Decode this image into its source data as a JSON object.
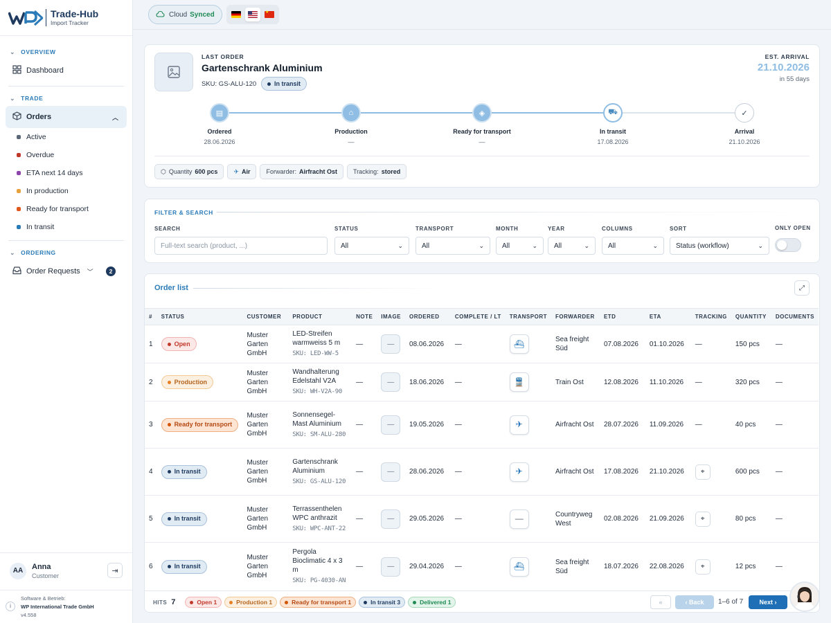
{
  "brand": {
    "title": "Trade-Hub",
    "subtitle": "Import Tracker"
  },
  "sidebar": {
    "overview_label": "OVERVIEW",
    "dashboard": "Dashboard",
    "trade_label": "TRADE",
    "orders": "Orders",
    "subitems": [
      {
        "label": "Active",
        "color": "#5a6777"
      },
      {
        "label": "Overdue",
        "color": "#c0392b"
      },
      {
        "label": "ETA next 14 days",
        "color": "#8e44ad"
      },
      {
        "label": "In production",
        "color": "#e6a23c"
      },
      {
        "label": "Ready for transport",
        "color": "#e0581c"
      },
      {
        "label": "In transit",
        "color": "#2b7bb9"
      }
    ],
    "ordering_label": "ORDERING",
    "order_requests": "Order Requests",
    "order_requests_count": "2"
  },
  "user": {
    "initials": "AA",
    "name": "Anna",
    "role": "Customer"
  },
  "footer": {
    "line1": "Software & Betrieb:",
    "line2": "WP International Trade GmbH",
    "version": "v4.558"
  },
  "topbar": {
    "cloud_label": "Cloud",
    "cloud_status": "Synced"
  },
  "last_order": {
    "label": "LAST ORDER",
    "title": "Gartenschrank Aluminium",
    "sku": "SKU: GS-ALU-120",
    "status": "In transit",
    "arrival_label": "EST. ARRIVAL",
    "arrival_date": "21.10.2026",
    "arrival_in": "in 55 days",
    "steps": [
      {
        "name": "Ordered",
        "date": "28.06.2026"
      },
      {
        "name": "Production",
        "date": "—"
      },
      {
        "name": "Ready for transport",
        "date": "—"
      },
      {
        "name": "In transit",
        "date": "17.08.2026"
      },
      {
        "name": "Arrival",
        "date": "21.10.2026"
      }
    ],
    "quantity_label": "Quantity",
    "quantity": "600 pcs",
    "mode": "Air",
    "forwarder_label": "Forwarder:",
    "forwarder": "Airfracht Ost",
    "tracking_label": "Tracking:",
    "tracking": "stored"
  },
  "filter": {
    "title": "FILTER & SEARCH",
    "search_label": "SEARCH",
    "search_placeholder": "Full-text search (product, ...)",
    "status_label": "STATUS",
    "status_value": "All",
    "transport_label": "TRANSPORT",
    "transport_value": "All",
    "month_label": "MONTH",
    "month_value": "All",
    "year_label": "YEAR",
    "year_value": "All",
    "columns_label": "COLUMNS",
    "columns_value": "All",
    "sort_label": "SORT",
    "sort_value": "Status (workflow)",
    "only_open_label": "ONLY OPEN"
  },
  "orders": {
    "title": "Order list",
    "columns": [
      "#",
      "STATUS",
      "CUSTOMER",
      "PRODUCT",
      "NOTE",
      "IMAGE",
      "ORDERED",
      "COMPLETE / LT",
      "TRANSPORT",
      "FORWARDER",
      "ETD",
      "ETA",
      "TRACKING",
      "QUANTITY",
      "DOCUMENTS"
    ],
    "rows": [
      {
        "n": "1",
        "status": "Open",
        "cls": "c-open",
        "customer": "Muster Garten GmbH",
        "product": "LED-Streifen warmweiss 5 m",
        "sku": "SKU: LED-WW-5",
        "note": "—",
        "ordered": "08.06.2026",
        "complete": "—",
        "transport": "ship",
        "forwarder": "Sea freight Süd",
        "etd": "07.08.2026",
        "eta": "01.10.2026",
        "tracking": "—",
        "quantity": "150 pcs",
        "documents": "—"
      },
      {
        "n": "2",
        "status": "Production",
        "cls": "c-prod",
        "customer": "Muster Garten GmbH",
        "product": "Wandhalterung Edelstahl V2A",
        "sku": "SKU: WH-V2A-90",
        "note": "—",
        "ordered": "18.06.2026",
        "complete": "—",
        "transport": "train",
        "forwarder": "Train Ost",
        "etd": "12.08.2026",
        "eta": "11.10.2026",
        "tracking": "—",
        "quantity": "320 pcs",
        "documents": "—"
      },
      {
        "n": "3",
        "status": "Ready for transport",
        "cls": "c-rft",
        "customer": "Muster Garten GmbH",
        "product": "Sonnensegel-Mast Aluminium",
        "sku": "SKU: SM-ALU-280",
        "note": "—",
        "ordered": "19.05.2026",
        "complete": "—",
        "transport": "plane",
        "forwarder": "Airfracht Ost",
        "etd": "28.07.2026",
        "eta": "11.09.2026",
        "tracking": "—",
        "quantity": "40 pcs",
        "documents": "—"
      },
      {
        "n": "4",
        "status": "In transit",
        "cls": "c-tran",
        "customer": "Muster Garten GmbH",
        "product": "Gartenschrank Aluminium",
        "sku": "SKU: GS-ALU-120",
        "note": "—",
        "ordered": "28.06.2026",
        "complete": "—",
        "transport": "plane",
        "forwarder": "Airfracht Ost",
        "etd": "17.08.2026",
        "eta": "21.10.2026",
        "tracking": "pin",
        "quantity": "600 pcs",
        "documents": "—"
      },
      {
        "n": "5",
        "status": "In transit",
        "cls": "c-tran",
        "customer": "Muster Garten GmbH",
        "product": "Terrassenthelen WPC anthrazit",
        "sku": "SKU: WPC-ANT-22",
        "note": "—",
        "ordered": "29.05.2026",
        "complete": "—",
        "transport": "none",
        "forwarder": "Countryweg West",
        "etd": "02.08.2026",
        "eta": "21.09.2026",
        "tracking": "pin",
        "quantity": "80 pcs",
        "documents": "—"
      },
      {
        "n": "6",
        "status": "In transit",
        "cls": "c-tran",
        "customer": "Muster Garten GmbH",
        "product": "Pergola Bioclimatic 4 x 3 m",
        "sku": "SKU: PG-4030-AN",
        "note": "—",
        "ordered": "29.04.2026",
        "complete": "—",
        "transport": "ship",
        "forwarder": "Sea freight Süd",
        "etd": "18.07.2026",
        "eta": "22.08.2026",
        "tracking": "pin",
        "quantity": "12 pcs",
        "documents": "—"
      }
    ]
  },
  "bottom": {
    "hits_label": "HITS",
    "hits": "7",
    "chips": [
      {
        "label": "Open 1",
        "cls": "c-open"
      },
      {
        "label": "Production 1",
        "cls": "c-prod"
      },
      {
        "label": "Ready for transport 1",
        "cls": "c-rft"
      },
      {
        "label": "In transit 3",
        "cls": "c-tran"
      },
      {
        "label": "Delivered 1",
        "cls": "c-del"
      }
    ],
    "first": "«",
    "back": "‹ Back",
    "range": "1–6 of 7",
    "next": "Next ›"
  }
}
